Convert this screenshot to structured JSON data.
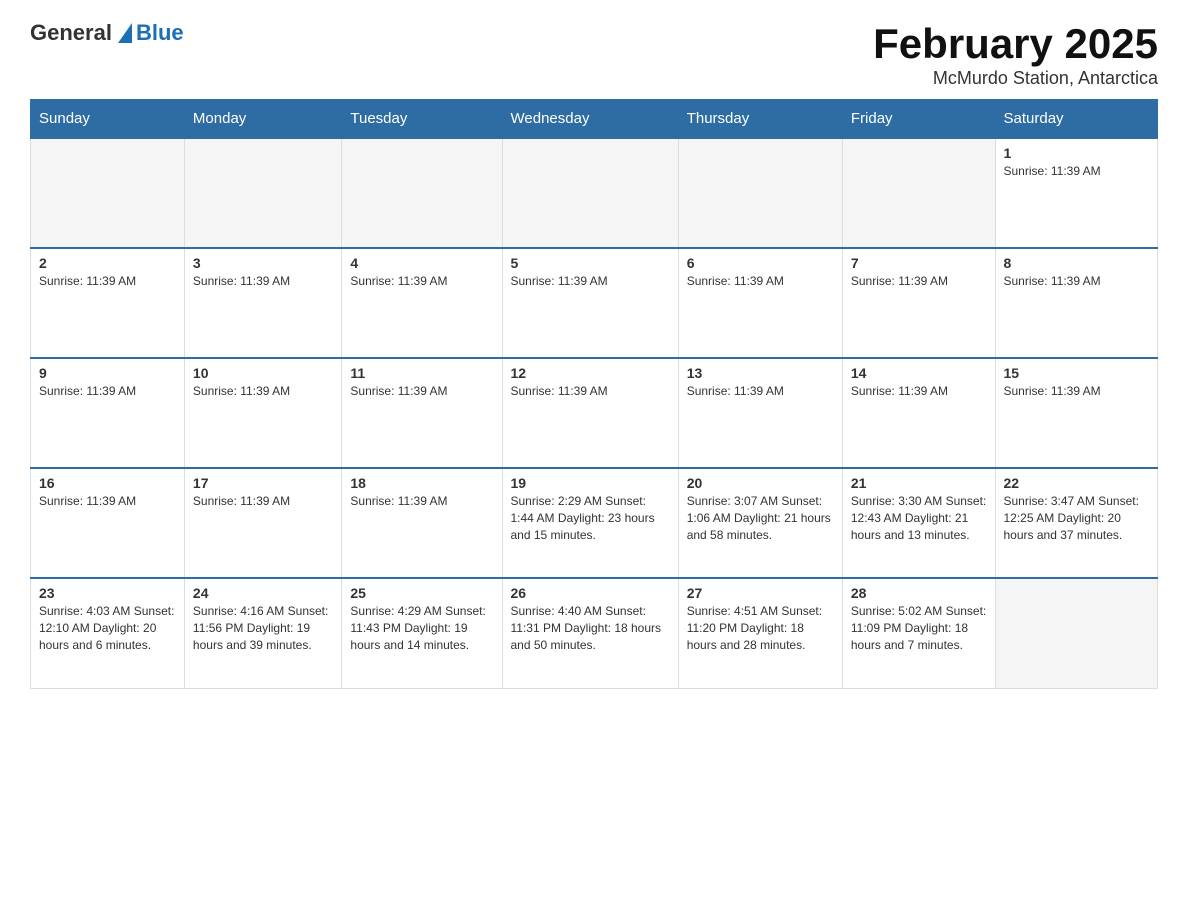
{
  "header": {
    "logo_text": "General",
    "logo_blue": "Blue",
    "title": "February 2025",
    "subtitle": "McMurdo Station, Antarctica"
  },
  "weekdays": [
    "Sunday",
    "Monday",
    "Tuesday",
    "Wednesday",
    "Thursday",
    "Friday",
    "Saturday"
  ],
  "weeks": [
    [
      {
        "day": "",
        "info": "",
        "empty": true
      },
      {
        "day": "",
        "info": "",
        "empty": true
      },
      {
        "day": "",
        "info": "",
        "empty": true
      },
      {
        "day": "",
        "info": "",
        "empty": true
      },
      {
        "day": "",
        "info": "",
        "empty": true
      },
      {
        "day": "",
        "info": "",
        "empty": true
      },
      {
        "day": "1",
        "info": "Sunrise: 11:39 AM"
      }
    ],
    [
      {
        "day": "2",
        "info": "Sunrise: 11:39 AM"
      },
      {
        "day": "3",
        "info": "Sunrise: 11:39 AM"
      },
      {
        "day": "4",
        "info": "Sunrise: 11:39 AM"
      },
      {
        "day": "5",
        "info": "Sunrise: 11:39 AM"
      },
      {
        "day": "6",
        "info": "Sunrise: 11:39 AM"
      },
      {
        "day": "7",
        "info": "Sunrise: 11:39 AM"
      },
      {
        "day": "8",
        "info": "Sunrise: 11:39 AM"
      }
    ],
    [
      {
        "day": "9",
        "info": "Sunrise: 11:39 AM"
      },
      {
        "day": "10",
        "info": "Sunrise: 11:39 AM"
      },
      {
        "day": "11",
        "info": "Sunrise: 11:39 AM"
      },
      {
        "day": "12",
        "info": "Sunrise: 11:39 AM"
      },
      {
        "day": "13",
        "info": "Sunrise: 11:39 AM"
      },
      {
        "day": "14",
        "info": "Sunrise: 11:39 AM"
      },
      {
        "day": "15",
        "info": "Sunrise: 11:39 AM"
      }
    ],
    [
      {
        "day": "16",
        "info": "Sunrise: 11:39 AM"
      },
      {
        "day": "17",
        "info": "Sunrise: 11:39 AM"
      },
      {
        "day": "18",
        "info": "Sunrise: 11:39 AM"
      },
      {
        "day": "19",
        "info": "Sunrise: 2:29 AM\nSunset: 1:44 AM\nDaylight: 23 hours and 15 minutes."
      },
      {
        "day": "20",
        "info": "Sunrise: 3:07 AM\nSunset: 1:06 AM\nDaylight: 21 hours and 58 minutes."
      },
      {
        "day": "21",
        "info": "Sunrise: 3:30 AM\nSunset: 12:43 AM\nDaylight: 21 hours and 13 minutes."
      },
      {
        "day": "22",
        "info": "Sunrise: 3:47 AM\nSunset: 12:25 AM\nDaylight: 20 hours and 37 minutes."
      }
    ],
    [
      {
        "day": "23",
        "info": "Sunrise: 4:03 AM\nSunset: 12:10 AM\nDaylight: 20 hours and 6 minutes."
      },
      {
        "day": "24",
        "info": "Sunrise: 4:16 AM\nSunset: 11:56 PM\nDaylight: 19 hours and 39 minutes."
      },
      {
        "day": "25",
        "info": "Sunrise: 4:29 AM\nSunset: 11:43 PM\nDaylight: 19 hours and 14 minutes."
      },
      {
        "day": "26",
        "info": "Sunrise: 4:40 AM\nSunset: 11:31 PM\nDaylight: 18 hours and 50 minutes."
      },
      {
        "day": "27",
        "info": "Sunrise: 4:51 AM\nSunset: 11:20 PM\nDaylight: 18 hours and 28 minutes."
      },
      {
        "day": "28",
        "info": "Sunrise: 5:02 AM\nSunset: 11:09 PM\nDaylight: 18 hours and 7 minutes."
      },
      {
        "day": "",
        "info": "",
        "empty": true
      }
    ]
  ]
}
